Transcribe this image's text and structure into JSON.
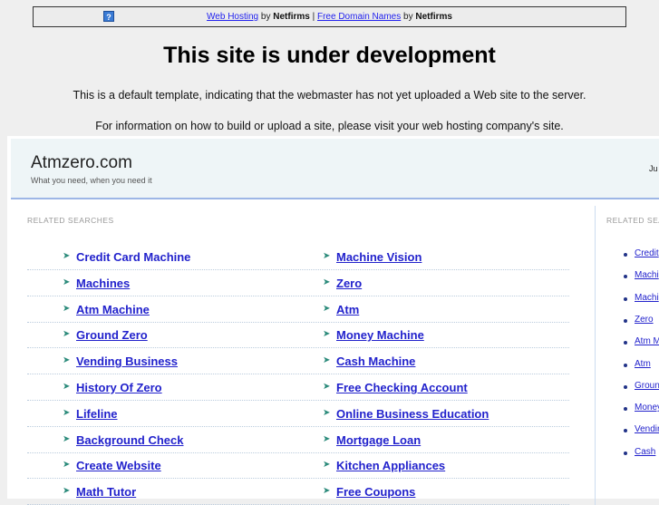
{
  "banner": {
    "help_icon": "question-icon",
    "help_text": "?",
    "link1": "Web Hosting",
    "by1": " by ",
    "brand1": "Netfirms",
    "sep": " | ",
    "link2": "Free Domain Names",
    "by2": " by ",
    "brand2": "Netfirms"
  },
  "title": "This site is under development",
  "para1": "This is a default template, indicating that the webmaster has not yet uploaded a Web site to the server.",
  "para2": "For information on how to build or upload a site, please visit your web hosting company's site.",
  "site": {
    "name": "Atmzero.com",
    "tagline": "What you need, when you need it",
    "right_text": "Ju"
  },
  "related_label": "RELATED SEARCHES",
  "side_label": "RELATED SEA",
  "col1": [
    "Credit Card Machine",
    "Machines",
    "Atm Machine",
    "Ground Zero",
    "Vending Business",
    "History Of Zero",
    "Lifeline",
    "Background Check",
    "Create Website",
    "Math Tutor"
  ],
  "col2": [
    "Machine Vision",
    "Zero",
    "Atm",
    "Money Machine",
    "Cash Machine",
    "Free Checking Account",
    "Online Business Education",
    "Mortgage Loan",
    "Kitchen Appliances",
    "Free Coupons"
  ],
  "side": [
    "Credit",
    "Machi",
    "Machi",
    "Zero",
    "Atm M",
    "Atm",
    "Groun",
    "Money",
    "Vendir",
    "Cash"
  ]
}
